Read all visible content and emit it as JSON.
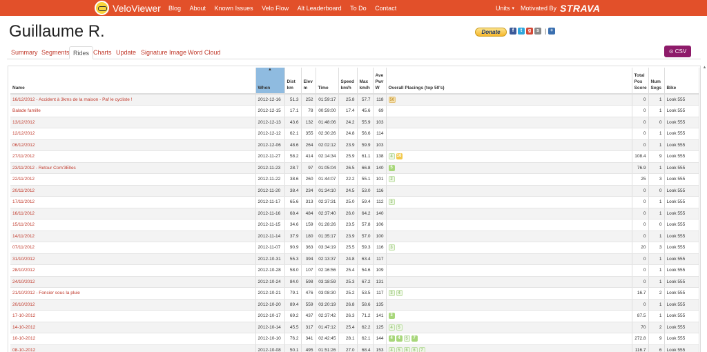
{
  "nav": {
    "brand": "VeloViewer",
    "links": [
      "Blog",
      "About",
      "Known Issues",
      "Velo Flow",
      "Alt Leaderboard",
      "To Do",
      "Contact"
    ],
    "units": "Units",
    "motivated": "Motivated By",
    "strava": "STRAVA"
  },
  "header": {
    "athlete": "Guillaume R.",
    "donate": "Donate",
    "csv": "CSV"
  },
  "tabs": [
    "Summary",
    "Segments",
    "Rides",
    "Charts",
    "Update",
    "Signature Image",
    "Word Cloud"
  ],
  "active_tab": "Rides",
  "columns": {
    "name": "Name",
    "when": "When",
    "dist": "Dist km",
    "elev": "Elev m",
    "time": "Time",
    "speed": "Speed km/h",
    "max": "Max km/h",
    "pwr": "Ave Pwr W",
    "placings": "Overall Placings (top 50's)",
    "pos": "Total Pos Score",
    "segs": "Num Segs",
    "bike": "Bike"
  },
  "rows": [
    {
      "name": "16/12/2012 - Accident à 3kms de la maison - Paf le cycliste !",
      "when": "2012-12-16",
      "dist": "51.3",
      "elev": "252",
      "time": "01:59:17",
      "speed": "25.8",
      "max": "57.7",
      "pwr": "118",
      "placings": [
        {
          "t": "beige",
          "v": "50"
        }
      ],
      "pos": "0",
      "segs": "1",
      "bike": "Look 555"
    },
    {
      "name": "Balade famille",
      "when": "2012-12-15",
      "dist": "17.1",
      "elev": "78",
      "time": "00:59:00",
      "speed": "17.4",
      "max": "45.6",
      "pwr": "69",
      "placings": [],
      "pos": "0",
      "segs": "1",
      "bike": "Look 555"
    },
    {
      "name": "13/12/2012",
      "when": "2012-12-13",
      "dist": "43.6",
      "elev": "132",
      "time": "01:48:06",
      "speed": "24.2",
      "max": "55.9",
      "pwr": "103",
      "placings": [],
      "pos": "0",
      "segs": "0",
      "bike": "Look 555"
    },
    {
      "name": "12/12/2012",
      "when": "2012-12-12",
      "dist": "62.1",
      "elev": "355",
      "time": "02:30:26",
      "speed": "24.8",
      "max": "56.6",
      "pwr": "114",
      "placings": [],
      "pos": "0",
      "segs": "1",
      "bike": "Look 555"
    },
    {
      "name": "06/12/2012",
      "when": "2012-12-06",
      "dist": "48.6",
      "elev": "264",
      "time": "02:02:12",
      "speed": "23.9",
      "max": "59.9",
      "pwr": "103",
      "placings": [],
      "pos": "0",
      "segs": "1",
      "bike": "Look 555"
    },
    {
      "name": "27/11/2012",
      "when": "2012-11-27",
      "dist": "58.2",
      "elev": "414",
      "time": "02:14:34",
      "speed": "25.9",
      "max": "61.1",
      "pwr": "138",
      "placings": [
        {
          "t": "faint",
          "v": "4"
        },
        {
          "t": "yellow",
          "v": "16"
        }
      ],
      "pos": "108.4",
      "segs": "9",
      "bike": "Look 555"
    },
    {
      "name": "23/11/2012 - Retour Com'3Elles",
      "when": "2012-11-23",
      "dist": "28.7",
      "elev": "97",
      "time": "01:05:04",
      "speed": "26.5",
      "max": "66.8",
      "pwr": "140",
      "placings": [
        {
          "t": "green",
          "v": "5"
        }
      ],
      "pos": "76.9",
      "segs": "1",
      "bike": "Look 555"
    },
    {
      "name": "22/11/2012",
      "when": "2012-11-22",
      "dist": "38.6",
      "elev": "260",
      "time": "01:44:07",
      "speed": "22.2",
      "max": "55.1",
      "pwr": "101",
      "placings": [
        {
          "t": "faint",
          "v": "2"
        }
      ],
      "pos": "25",
      "segs": "3",
      "bike": "Look 555"
    },
    {
      "name": "20/11/2012",
      "when": "2012-11-20",
      "dist": "38.4",
      "elev": "234",
      "time": "01:34:10",
      "speed": "24.5",
      "max": "53.0",
      "pwr": "116",
      "placings": [],
      "pos": "0",
      "segs": "0",
      "bike": "Look 555"
    },
    {
      "name": "17/11/2012",
      "when": "2012-11-17",
      "dist": "65.6",
      "elev": "313",
      "time": "02:37:31",
      "speed": "25.0",
      "max": "59.4",
      "pwr": "112",
      "placings": [
        {
          "t": "faint",
          "v": "3"
        }
      ],
      "pos": "0",
      "segs": "1",
      "bike": "Look 555"
    },
    {
      "name": "16/11/2012",
      "when": "2012-11-16",
      "dist": "68.4",
      "elev": "484",
      "time": "02:37:40",
      "speed": "26.0",
      "max": "64.2",
      "pwr": "140",
      "placings": [],
      "pos": "0",
      "segs": "1",
      "bike": "Look 555"
    },
    {
      "name": "15/11/2012",
      "when": "2012-11-15",
      "dist": "34.6",
      "elev": "159",
      "time": "01:28:26",
      "speed": "23.5",
      "max": "57.8",
      "pwr": "106",
      "placings": [],
      "pos": "0",
      "segs": "0",
      "bike": "Look 555"
    },
    {
      "name": "14/11/2012",
      "when": "2012-11-14",
      "dist": "37.9",
      "elev": "180",
      "time": "01:35:17",
      "speed": "23.9",
      "max": "57.0",
      "pwr": "100",
      "placings": [],
      "pos": "0",
      "segs": "1",
      "bike": "Look 555"
    },
    {
      "name": "07/11/2012",
      "when": "2012-11-07",
      "dist": "90.9",
      "elev": "363",
      "time": "03:34:19",
      "speed": "25.5",
      "max": "59.3",
      "pwr": "116",
      "placings": [
        {
          "t": "faint",
          "v": "3"
        }
      ],
      "pos": "20",
      "segs": "3",
      "bike": "Look 555"
    },
    {
      "name": "31/10/2012",
      "when": "2012-10-31",
      "dist": "55.3",
      "elev": "394",
      "time": "02:13:37",
      "speed": "24.8",
      "max": "63.4",
      "pwr": "117",
      "placings": [],
      "pos": "0",
      "segs": "1",
      "bike": "Look 555"
    },
    {
      "name": "28/10/2012",
      "when": "2012-10-28",
      "dist": "58.0",
      "elev": "107",
      "time": "02:16:56",
      "speed": "25.4",
      "max": "54.6",
      "pwr": "109",
      "placings": [],
      "pos": "0",
      "segs": "1",
      "bike": "Look 555"
    },
    {
      "name": "24/10/2012",
      "when": "2012-10-24",
      "dist": "84.0",
      "elev": "598",
      "time": "03:18:59",
      "speed": "25.3",
      "max": "67.2",
      "pwr": "131",
      "placings": [],
      "pos": "0",
      "segs": "1",
      "bike": "Look 555"
    },
    {
      "name": "21/10/2012 - Foncier sous la pluie",
      "when": "2012-10-21",
      "dist": "79.1",
      "elev": "476",
      "time": "03:08:30",
      "speed": "25.2",
      "max": "53.5",
      "pwr": "117",
      "placings": [
        {
          "t": "faint",
          "v": "3"
        },
        {
          "t": "faint",
          "v": "4"
        }
      ],
      "pos": "16.7",
      "segs": "2",
      "bike": "Look 555"
    },
    {
      "name": "20/10/2012",
      "when": "2012-10-20",
      "dist": "89.4",
      "elev": "559",
      "time": "03:20:19",
      "speed": "26.8",
      "max": "58.6",
      "pwr": "135",
      "placings": [],
      "pos": "0",
      "segs": "1",
      "bike": "Look 555"
    },
    {
      "name": "17-10-2012",
      "when": "2012-10-17",
      "dist": "69.2",
      "elev": "437",
      "time": "02:37:42",
      "speed": "26.3",
      "max": "71.2",
      "pwr": "141",
      "placings": [
        {
          "t": "green",
          "v": "3"
        }
      ],
      "pos": "87.5",
      "segs": "1",
      "bike": "Look 555"
    },
    {
      "name": "14-10-2012",
      "when": "2012-10-14",
      "dist": "45.5",
      "elev": "317",
      "time": "01:47:12",
      "speed": "25.4",
      "max": "62.2",
      "pwr": "125",
      "placings": [
        {
          "t": "faint",
          "v": "4"
        },
        {
          "t": "faint",
          "v": "5"
        }
      ],
      "pos": "70",
      "segs": "2",
      "bike": "Look 555"
    },
    {
      "name": "10-10-2012",
      "when": "2012-10-10",
      "dist": "76.2",
      "elev": "341",
      "time": "02:42:45",
      "speed": "28.1",
      "max": "62.1",
      "pwr": "144",
      "placings": [
        {
          "t": "green",
          "v": "4"
        },
        {
          "t": "green",
          "v": "4"
        },
        {
          "t": "faint",
          "v": "5"
        },
        {
          "t": "green",
          "v": "7"
        }
      ],
      "pos": "272.8",
      "segs": "9",
      "bike": "Look 555"
    },
    {
      "name": "08-10-2012",
      "when": "2012-10-08",
      "dist": "50.1",
      "elev": "495",
      "time": "01:51:26",
      "speed": "27.0",
      "max": "68.4",
      "pwr": "153",
      "placings": [
        {
          "t": "faint",
          "v": "4"
        },
        {
          "t": "faint",
          "v": "5"
        },
        {
          "t": "faint",
          "v": "6"
        },
        {
          "t": "faint",
          "v": "6"
        },
        {
          "t": "faint",
          "v": "7"
        }
      ],
      "pos": "116.7",
      "segs": "6",
      "bike": "Look 555"
    }
  ]
}
